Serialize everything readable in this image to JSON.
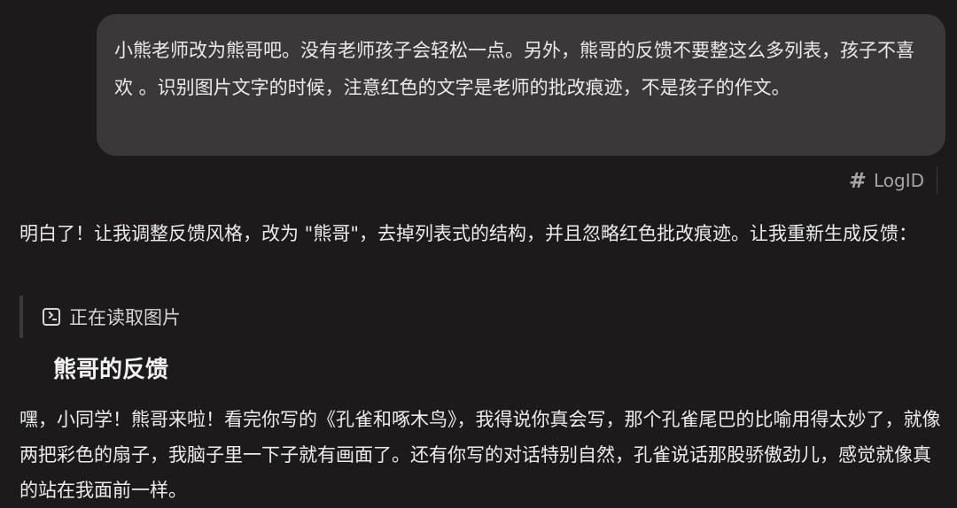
{
  "user_message": {
    "text": "小熊老师改为熊哥吧。没有老师孩子会轻松一点。另外，熊哥的反馈不要整这么多列表，孩子不喜欢 。识别图片文字的时候，注意红色的文字是老师的批改痕迹，不是孩子的作文。"
  },
  "logid": {
    "icon": "hash-icon",
    "label": "LogID"
  },
  "assistant": {
    "intro": "明白了！让我调整反馈风格，改为 \"熊哥\"，去掉列表式的结构，并且忽略红色批改痕迹。让我重新生成反馈：",
    "tool_status": {
      "icon": "terminal-icon",
      "label": "正在读取图片"
    },
    "heading": "熊哥的反馈",
    "paragraph": "嘿，小同学！熊哥来啦！看完你写的《孔雀和啄木鸟》，我得说你真会写，那个孔雀尾巴的比喻用得太妙了，就像两把彩色的扇子，我脑子里一下子就有画面了。还有你写的对话特别自然，孔雀说话那股骄傲劲儿，感觉就像真的站在我面前一样。"
  },
  "colors": {
    "background": "#1c1a1a",
    "bubble": "#3a3838",
    "text": "#ececec",
    "muted": "#a8a6a4"
  }
}
